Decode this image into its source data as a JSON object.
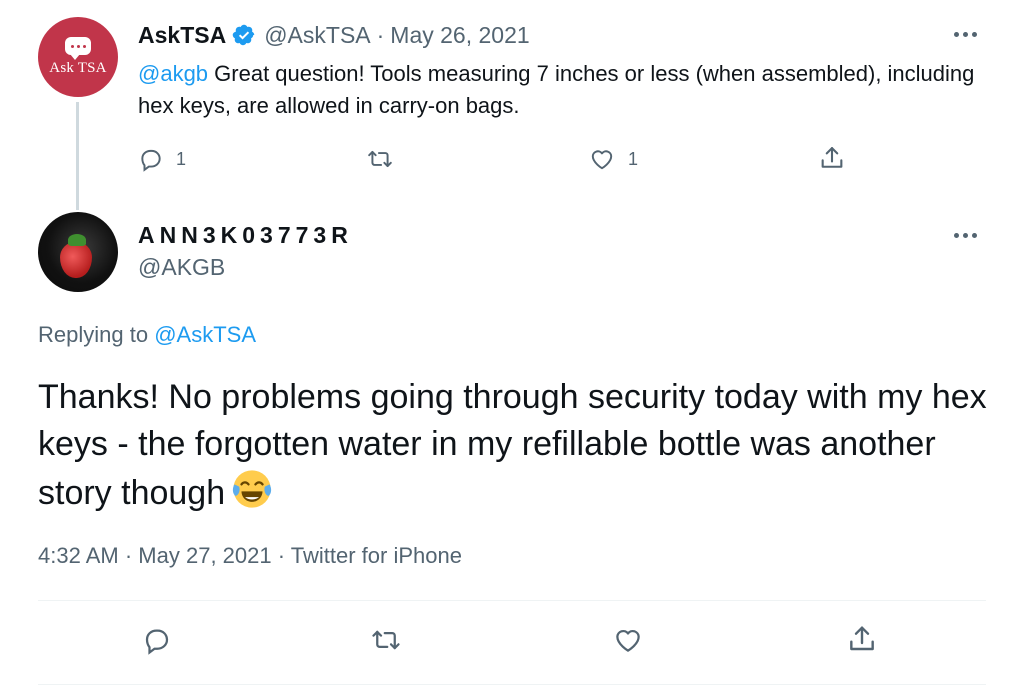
{
  "parent_tweet": {
    "display_name": "AskTSA",
    "handle": "@AskTSA",
    "separator": "·",
    "date": "May 26, 2021",
    "avatar_text": "Ask TSA",
    "mention": "@akgb",
    "text": "Great question! Tools measuring 7 inches or less (when assembled), including hex keys, are allowed in carry-on bags.",
    "reply_count": "1",
    "like_count": "1"
  },
  "reply_tweet": {
    "display_name": "ANN3K03773R",
    "handle": "@AKGB",
    "replying_prefix": "Replying to",
    "replying_to": "@AskTSA",
    "text": "Thanks! No problems going through security today with my hex keys - the forgotten water in my refillable bottle was another story though",
    "time": "4:32 AM",
    "separator": "·",
    "date": "May 27, 2021",
    "source": "Twitter for iPhone"
  },
  "icons": {
    "reply": "reply-icon",
    "retweet": "retweet-icon",
    "like": "like-icon",
    "share": "share-icon",
    "more": "more-icon",
    "verified": "verified-badge-icon",
    "emoji": "face-with-tears-of-joy-emoji"
  },
  "colors": {
    "accent": "#1d9bf0",
    "secondary_text": "#536471",
    "avatar_tsa": "#c1354a"
  }
}
